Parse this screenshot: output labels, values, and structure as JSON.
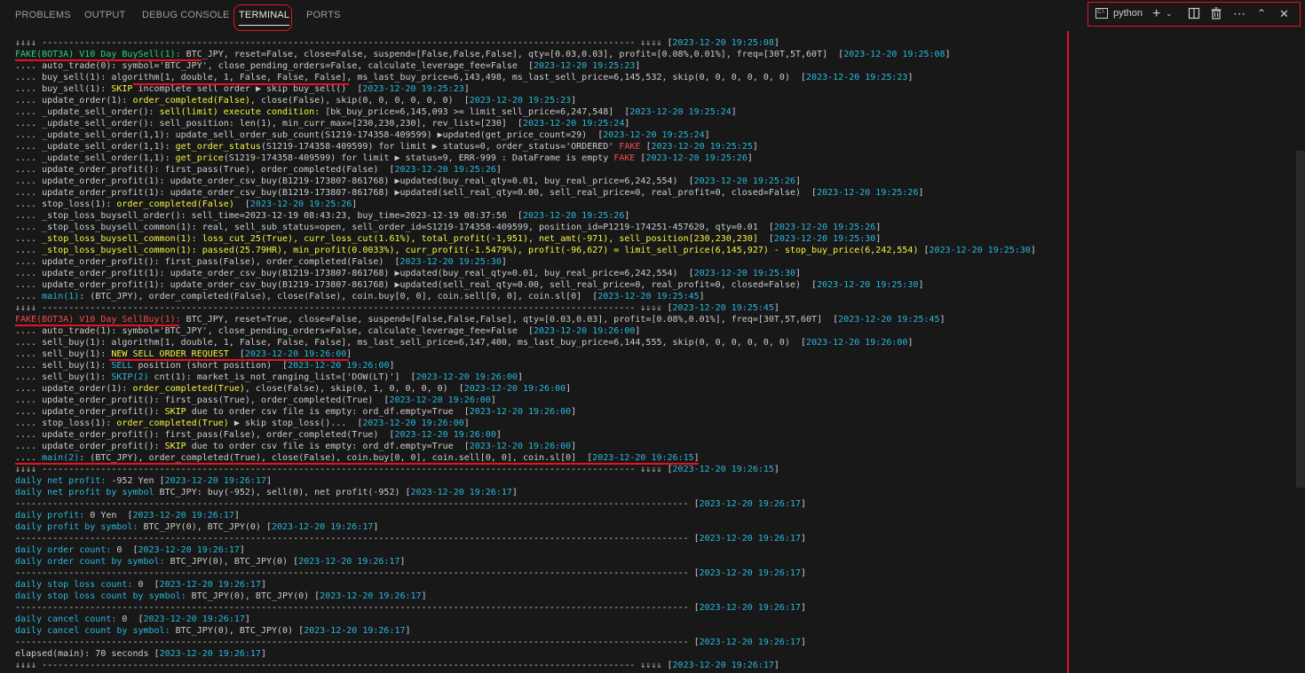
{
  "panel": {
    "tabs": [
      {
        "label": "PROBLEMS"
      },
      {
        "label": "OUTPUT"
      },
      {
        "label": "DEBUG CONSOLE"
      },
      {
        "label": "TERMINAL"
      },
      {
        "label": "PORTS"
      }
    ],
    "terminal_name": "python"
  },
  "colors": {
    "accent": "#e81123",
    "green": "#23d18b",
    "yellow": "#f5f543",
    "cyan": "#29b8db",
    "red": "#f14c4c"
  },
  "lines": [
    [
      [
        "w",
        "⇓⇓⇓⇓ --------------------------------------------------------------------------------------------------------------- ⇓⇓⇓⇓ ["
      ],
      [
        "c",
        "2023-12-20 19:25:08"
      ],
      [
        "w",
        "]"
      ]
    ],
    [
      [
        "g",
        "FAKE(BOT3A) V10 Day BuySell(1):"
      ],
      [
        "w",
        " BTC_JPY, reset=False, close=False, suspend=[False,False,False], qty=[0.03,0.03], profit=[0.08%,0.01%], freq=[30T,5T,60T]  ["
      ],
      [
        "c",
        "2023-12-20 19:25:08"
      ],
      [
        "w",
        "]"
      ]
    ],
    [
      [
        "w",
        ".... auto_trade(0): symbol='BTC_JPY', close_pending_orders=False, calculate_leverage_fee=False  ["
      ],
      [
        "c",
        "2023-12-20 19:25:23"
      ],
      [
        "w",
        "]"
      ]
    ],
    [
      [
        "w",
        ".... buy_sell(1): algorithm[1, double, 1, False, False, False], ms_last_buy_price=6,143,498, ms_last_sell_price=6,145,532, skip(0, 0, 0, 0, 0, 0)  ["
      ],
      [
        "c",
        "2023-12-20 19:25:23"
      ],
      [
        "w",
        "]"
      ]
    ],
    [
      [
        "w",
        ".... buy_sell(1): "
      ],
      [
        "y",
        "SKIP"
      ],
      [
        "w",
        " incomplete sell order ▶ skip buy_sell()  ["
      ],
      [
        "c",
        "2023-12-20 19:25:23"
      ],
      [
        "w",
        "]"
      ]
    ],
    [
      [
        "w",
        ".... update_order(1): "
      ],
      [
        "y",
        "order_completed(False)"
      ],
      [
        "w",
        ", close(False), skip(0, 0, 0, 0, 0, 0)  ["
      ],
      [
        "c",
        "2023-12-20 19:25:23"
      ],
      [
        "w",
        "]"
      ]
    ],
    [
      [
        "w",
        ".... _update_sell_order(): "
      ],
      [
        "y",
        "sell(limit) execute condition:"
      ],
      [
        "w",
        " [bk_buy_price=6,145,093 >= limit_sell_price=6,247,548]  ["
      ],
      [
        "c",
        "2023-12-20 19:25:24"
      ],
      [
        "w",
        "]"
      ]
    ],
    [
      [
        "w",
        ".... _update_sell_order(): sell_position: len(1), min_curr_max=[230,230,230], rev_list=[230]  ["
      ],
      [
        "c",
        "2023-12-20 19:25:24"
      ],
      [
        "w",
        "]"
      ]
    ],
    [
      [
        "w",
        ".... _update_sell_order(1,1): update_sell_order_sub_count(S1219-174358-409599) ▶updated(get_price_count=29)  ["
      ],
      [
        "c",
        "2023-12-20 19:25:24"
      ],
      [
        "w",
        "]"
      ]
    ],
    [
      [
        "w",
        ".... _update_sell_order(1,1): "
      ],
      [
        "y",
        "get_order_status"
      ],
      [
        "w",
        "(S1219-174358-409599) for limit ▶ status=0, order_status='ORDERED' "
      ],
      [
        "r",
        "FAKE"
      ],
      [
        "w",
        " ["
      ],
      [
        "c",
        "2023-12-20 19:25:25"
      ],
      [
        "w",
        "]"
      ]
    ],
    [
      [
        "w",
        ".... _update_sell_order(1,1): "
      ],
      [
        "y",
        "get_price"
      ],
      [
        "w",
        "(S1219-174358-409599) for limit ▶ status=9, ERR-999 : DataFrame is empty "
      ],
      [
        "r",
        "FAKE"
      ],
      [
        "w",
        " ["
      ],
      [
        "c",
        "2023-12-20 19:25:26"
      ],
      [
        "w",
        "]"
      ]
    ],
    [
      [
        "w",
        ".... update_order_profit(): first_pass(True), order_completed(False)  ["
      ],
      [
        "c",
        "2023-12-20 19:25:26"
      ],
      [
        "w",
        "]"
      ]
    ],
    [
      [
        "w",
        ".... update_order_profit(1): update_order_csv_buy(B1219-173807-861768) ▶updated(buy_real_qty=0.01, buy_real_price=6,242,554)  ["
      ],
      [
        "c",
        "2023-12-20 19:25:26"
      ],
      [
        "w",
        "]"
      ]
    ],
    [
      [
        "w",
        ".... update_order_profit(1): update_order_csv_buy(B1219-173807-861768) ▶updated(sell_real_qty=0.00, sell_real_price=0, real_profit=0, closed=False)  ["
      ],
      [
        "c",
        "2023-12-20 19:25:26"
      ],
      [
        "w",
        "]"
      ]
    ],
    [
      [
        "w",
        ".... stop_loss(1): "
      ],
      [
        "y",
        "order_completed(False)"
      ],
      [
        "w",
        "  ["
      ],
      [
        "c",
        "2023-12-20 19:25:26"
      ],
      [
        "w",
        "]"
      ]
    ],
    [
      [
        "w",
        ".... _stop_loss_buysell_order(): sell_time=2023-12-19 08:43:23, buy_time=2023-12-19 08:37:56  ["
      ],
      [
        "c",
        "2023-12-20 19:25:26"
      ],
      [
        "w",
        "]"
      ]
    ],
    [
      [
        "w",
        ".... _stop_loss_buysell_common(1): real, sell_sub_status=open, sell_order_id=S1219-174358-409599, position_id=P1219-174251-457620, qty=0.01  ["
      ],
      [
        "c",
        "2023-12-20 19:25:26"
      ],
      [
        "w",
        "]"
      ]
    ],
    [
      [
        "w",
        ".... "
      ],
      [
        "y",
        "_stop_loss_buysell_common(1): loss_cut_25(True), curr_loss_cut(1.61%), total_profit(-1,951), net_amt(-971), sell_position[230,230,230]"
      ],
      [
        "w",
        "  ["
      ],
      [
        "c",
        "2023-12-20 19:25:30"
      ],
      [
        "w",
        "]"
      ]
    ],
    [
      [
        "w",
        ".... "
      ],
      [
        "y",
        "_stop_loss_buysell_common(1): passed(25.79HR), min_profit(0.0033%), curr_profit(-1.5479%), profit(-96,627) = limit_sell_price(6,145,927) - stop_buy_price(6,242,554)"
      ],
      [
        "w",
        " ["
      ],
      [
        "c",
        "2023-12-20 19:25:30"
      ],
      [
        "w",
        "]"
      ]
    ],
    [
      [
        "w",
        ".... update_order_profit(): first_pass(False), order_completed(False)  ["
      ],
      [
        "c",
        "2023-12-20 19:25:30"
      ],
      [
        "w",
        "]"
      ]
    ],
    [
      [
        "w",
        ".... update_order_profit(1): update_order_csv_buy(B1219-173807-861768) ▶updated(buy_real_qty=0.01, buy_real_price=6,242,554)  ["
      ],
      [
        "c",
        "2023-12-20 19:25:30"
      ],
      [
        "w",
        "]"
      ]
    ],
    [
      [
        "w",
        ".... update_order_profit(1): update_order_csv_buy(B1219-173807-861768) ▶updated(sell_real_qty=0.00, sell_real_price=0, real_profit=0, closed=False)  ["
      ],
      [
        "c",
        "2023-12-20 19:25:30"
      ],
      [
        "w",
        "]"
      ]
    ],
    [
      [
        "w",
        ".... "
      ],
      [
        "c",
        "main(1)"
      ],
      [
        "w",
        ": (BTC_JPY), order_completed(False), close(False), coin.buy[0, 0], coin.sell[0, 0], coin.sl[0]  ["
      ],
      [
        "c",
        "2023-12-20 19:25:45"
      ],
      [
        "w",
        "]"
      ]
    ],
    [
      [
        "w",
        "⇓⇓⇓⇓ --------------------------------------------------------------------------------------------------------------- ⇓⇓⇓⇓ ["
      ],
      [
        "c",
        "2023-12-20 19:25:45"
      ],
      [
        "w",
        "]"
      ]
    ],
    [
      [
        "r",
        "FAKE(BOT3A) V10 Day SellBuy(1):"
      ],
      [
        "w",
        " BTC_JPY, reset=True, close=False, suspend=[False,False,False], qty=[0.03,0.03], profit=[0.08%,0.01%], freq=[30T,5T,60T]  ["
      ],
      [
        "c",
        "2023-12-20 19:25:45"
      ],
      [
        "w",
        "]"
      ]
    ],
    [
      [
        "w",
        ".... auto_trade(1): symbol='BTC_JPY', close_pending_orders=False, calculate_leverage_fee=False  ["
      ],
      [
        "c",
        "2023-12-20 19:26:00"
      ],
      [
        "w",
        "]"
      ]
    ],
    [
      [
        "w",
        ".... sell_buy(1): algorithm[1, double, 1, False, False, False], ms_last_sell_price=6,147,400, ms_last_buy_price=6,144,555, skip(0, 0, 0, 0, 0, 0)  ["
      ],
      [
        "c",
        "2023-12-20 19:26:00"
      ],
      [
        "w",
        "]"
      ]
    ],
    [
      [
        "w",
        ".... sell_buy(1): "
      ],
      [
        "y",
        "NEW SELL ORDER REQUEST"
      ],
      [
        "w",
        "  ["
      ],
      [
        "c",
        "2023-12-20 19:26:00"
      ],
      [
        "w",
        "]"
      ]
    ],
    [
      [
        "w",
        ".... sell_buy(1): "
      ],
      [
        "c",
        "SELL"
      ],
      [
        "w",
        " position (short position)  ["
      ],
      [
        "c",
        "2023-12-20 19:26:00"
      ],
      [
        "w",
        "]"
      ]
    ],
    [
      [
        "w",
        ".... sell_buy(1): "
      ],
      [
        "c",
        "SKIP(2)"
      ],
      [
        "w",
        " cnt(1): market_is_not_ranging_list=['DOW(LT)']  ["
      ],
      [
        "c",
        "2023-12-20 19:26:00"
      ],
      [
        "w",
        "]"
      ]
    ],
    [
      [
        "w",
        ".... update_order(1): "
      ],
      [
        "y",
        "order_completed(True)"
      ],
      [
        "w",
        ", close(False), skip(0, 1, 0, 0, 0, 0)  ["
      ],
      [
        "c",
        "2023-12-20 19:26:00"
      ],
      [
        "w",
        "]"
      ]
    ],
    [
      [
        "w",
        ".... update_order_profit(): first_pass(True), order_completed(True)  ["
      ],
      [
        "c",
        "2023-12-20 19:26:00"
      ],
      [
        "w",
        "]"
      ]
    ],
    [
      [
        "w",
        ".... update_order_profit(): "
      ],
      [
        "y",
        "SKIP"
      ],
      [
        "w",
        " due to order csv file is empty: ord_df.empty=True  ["
      ],
      [
        "c",
        "2023-12-20 19:26:00"
      ],
      [
        "w",
        "]"
      ]
    ],
    [
      [
        "w",
        ".... stop_loss(1): "
      ],
      [
        "y",
        "order_completed(True)"
      ],
      [
        "w",
        " ▶ skip stop_loss()...  ["
      ],
      [
        "c",
        "2023-12-20 19:26:00"
      ],
      [
        "w",
        "]"
      ]
    ],
    [
      [
        "w",
        ".... update_order_profit(): first_pass(False), order_completed(True)  ["
      ],
      [
        "c",
        "2023-12-20 19:26:00"
      ],
      [
        "w",
        "]"
      ]
    ],
    [
      [
        "w",
        ".... update_order_profit(): "
      ],
      [
        "y",
        "SKIP"
      ],
      [
        "w",
        " due to order csv file is empty: ord_df.empty=True  ["
      ],
      [
        "c",
        "2023-12-20 19:26:00"
      ],
      [
        "w",
        "]"
      ]
    ],
    [
      [
        "w",
        ".... "
      ],
      [
        "c",
        "main(2)"
      ],
      [
        "w",
        ": (BTC_JPY), order_completed(True), close(False), coin.buy[0, 0], coin.sell[0, 0], coin.sl[0]  ["
      ],
      [
        "c",
        "2023-12-20 19:26:15"
      ],
      [
        "w",
        "]"
      ]
    ],
    [
      [
        "w",
        "⇓⇓⇓⇓ --------------------------------------------------------------------------------------------------------------- ⇓⇓⇓⇓ ["
      ],
      [
        "c",
        "2023-12-20 19:26:15"
      ],
      [
        "w",
        "]"
      ]
    ],
    [
      [
        "c",
        "daily net profit:"
      ],
      [
        "w",
        " -952 Yen ["
      ],
      [
        "c",
        "2023-12-20 19:26:17"
      ],
      [
        "w",
        "]"
      ]
    ],
    [
      [
        "c",
        "daily net profit by symbol"
      ],
      [
        "w",
        " BTC_JPY: buy(-952), sell(0), net profit(-952) ["
      ],
      [
        "c",
        "2023-12-20 19:26:17"
      ],
      [
        "w",
        "]"
      ]
    ],
    [
      [
        "w",
        "------------------------------------------------------------------------------------------------------------------------------ ["
      ],
      [
        "c",
        "2023-12-20 19:26:17"
      ],
      [
        "w",
        "]"
      ]
    ],
    [
      [
        "c",
        "daily profit:"
      ],
      [
        "w",
        " 0 Yen  ["
      ],
      [
        "c",
        "2023-12-20 19:26:17"
      ],
      [
        "w",
        "]"
      ]
    ],
    [
      [
        "c",
        "daily profit by symbol:"
      ],
      [
        "w",
        " BTC_JPY(0), BTC_JPY(0) ["
      ],
      [
        "c",
        "2023-12-20 19:26:17"
      ],
      [
        "w",
        "]"
      ]
    ],
    [
      [
        "w",
        "------------------------------------------------------------------------------------------------------------------------------ ["
      ],
      [
        "c",
        "2023-12-20 19:26:17"
      ],
      [
        "w",
        "]"
      ]
    ],
    [
      [
        "c",
        "daily order count:"
      ],
      [
        "w",
        " 0  ["
      ],
      [
        "c",
        "2023-12-20 19:26:17"
      ],
      [
        "w",
        "]"
      ]
    ],
    [
      [
        "c",
        "daily order count by symbol:"
      ],
      [
        "w",
        " BTC_JPY(0), BTC_JPY(0) ["
      ],
      [
        "c",
        "2023-12-20 19:26:17"
      ],
      [
        "w",
        "]"
      ]
    ],
    [
      [
        "w",
        "------------------------------------------------------------------------------------------------------------------------------ ["
      ],
      [
        "c",
        "2023-12-20 19:26:17"
      ],
      [
        "w",
        "]"
      ]
    ],
    [
      [
        "c",
        "daily stop loss count:"
      ],
      [
        "w",
        " 0  ["
      ],
      [
        "c",
        "2023-12-20 19:26:17"
      ],
      [
        "w",
        "]"
      ]
    ],
    [
      [
        "c",
        "daily stop loss count by symbol:"
      ],
      [
        "w",
        " BTC_JPY(0), BTC_JPY(0) ["
      ],
      [
        "c",
        "2023-12-20 19:26:17"
      ],
      [
        "w",
        "]"
      ]
    ],
    [
      [
        "w",
        "------------------------------------------------------------------------------------------------------------------------------ ["
      ],
      [
        "c",
        "2023-12-20 19:26:17"
      ],
      [
        "w",
        "]"
      ]
    ],
    [
      [
        "c",
        "daily cancel count:"
      ],
      [
        "w",
        " 0  ["
      ],
      [
        "c",
        "2023-12-20 19:26:17"
      ],
      [
        "w",
        "]"
      ]
    ],
    [
      [
        "c",
        "daily cancel count by symbol:"
      ],
      [
        "w",
        " BTC_JPY(0), BTC_JPY(0) ["
      ],
      [
        "c",
        "2023-12-20 19:26:17"
      ],
      [
        "w",
        "]"
      ]
    ],
    [
      [
        "w",
        "------------------------------------------------------------------------------------------------------------------------------ ["
      ],
      [
        "c",
        "2023-12-20 19:26:17"
      ],
      [
        "w",
        "]"
      ]
    ],
    [
      [
        "w",
        "elapsed(main): 70 seconds ["
      ],
      [
        "c",
        "2023-12-20 19:26:17"
      ],
      [
        "w",
        "]"
      ]
    ],
    [
      [
        "w",
        "⇓⇓⇓⇓ --------------------------------------------------------------------------------------------------------------- ⇓⇓⇓⇓ ["
      ],
      [
        "c",
        "2023-12-20 19:26:17"
      ],
      [
        "w",
        "]"
      ]
    ]
  ]
}
